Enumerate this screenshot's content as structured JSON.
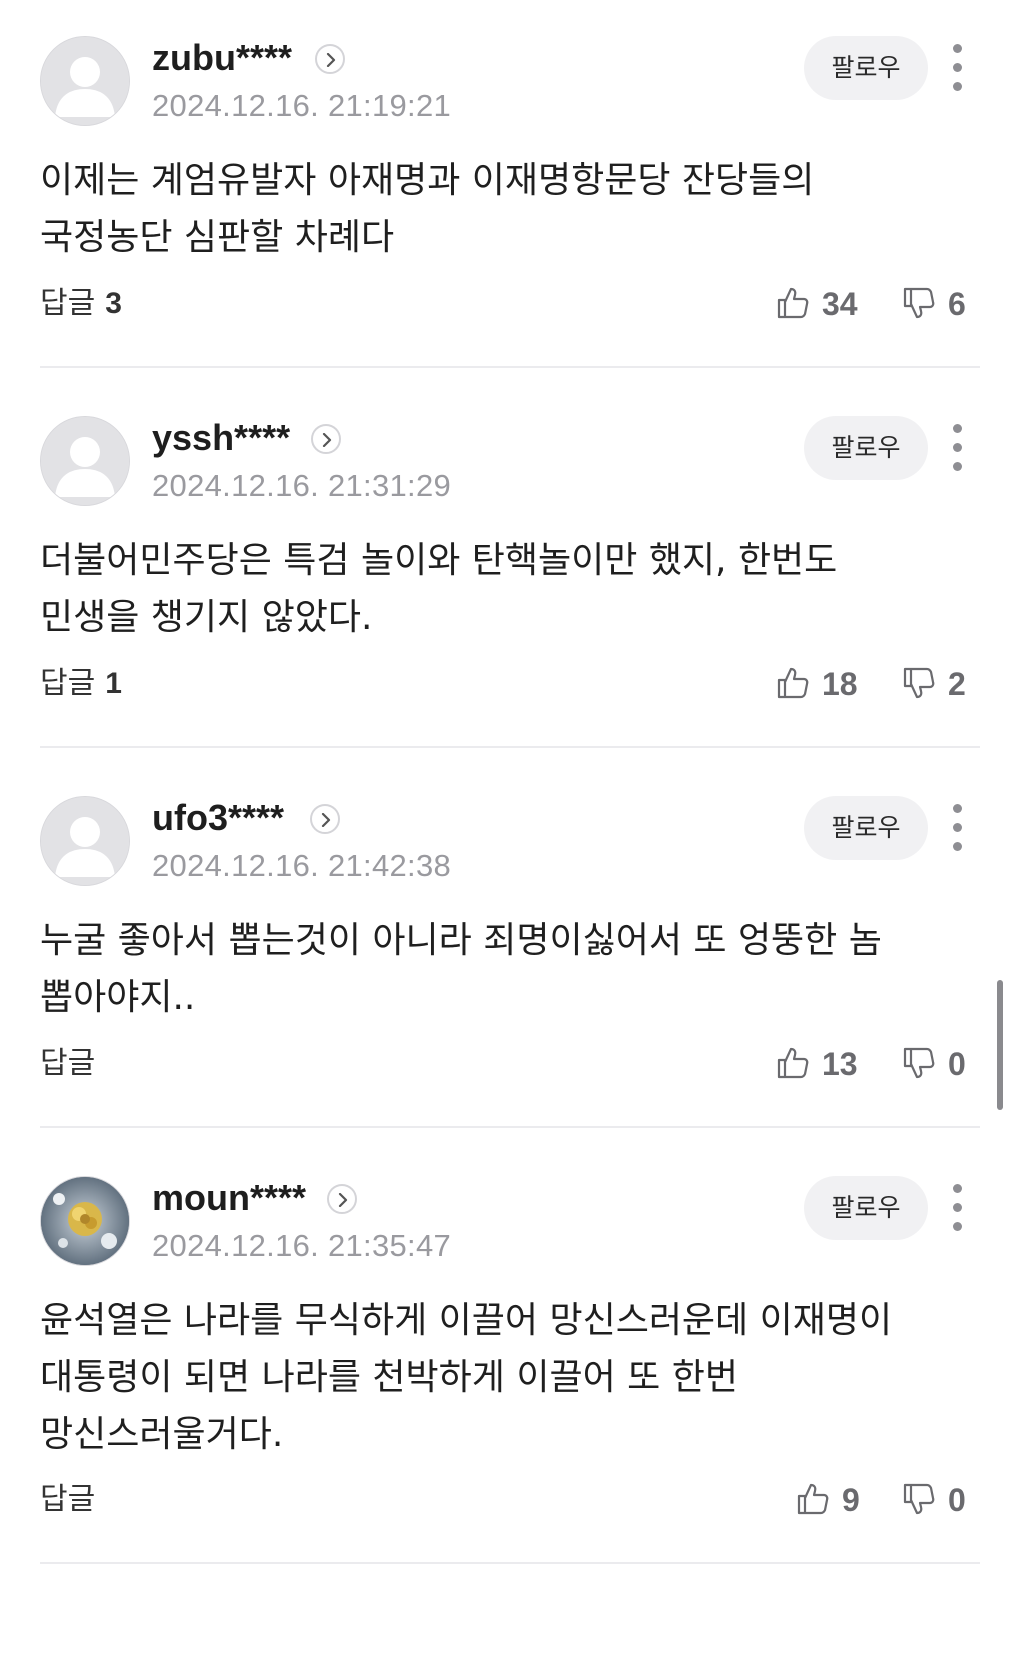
{
  "comments": [
    {
      "username": "zubu****",
      "timestamp": "2024.12.16. 21:19:21",
      "follow_label": "팔로우",
      "body": "이제는 계엄유발자 아재명과 이재명항문당 잔당들의 국정농단 심판할 차례다",
      "reply_label": "답글",
      "reply_count": "3",
      "likes": "34",
      "dislikes": "6",
      "avatar": "default-avatar-icon"
    },
    {
      "username": "yssh****",
      "timestamp": "2024.12.16. 21:31:29",
      "follow_label": "팔로우",
      "body": "더불어민주당은 특검 놀이와 탄핵놀이만 했지, 한번도 민생을 챙기지 않았다.",
      "reply_label": "답글",
      "reply_count": "1",
      "likes": "18",
      "dislikes": "2",
      "avatar": "default-avatar-icon"
    },
    {
      "username": "ufo3****",
      "timestamp": "2024.12.16. 21:42:38",
      "follow_label": "팔로우",
      "body": "누굴 좋아서 뽑는것이 아니라 죄명이싫어서 또 엉뚱한 놈 뽑아야지..",
      "reply_label": "답글",
      "reply_count": "",
      "likes": "13",
      "dislikes": "0",
      "avatar": "default-avatar-icon"
    },
    {
      "username": "moun****",
      "timestamp": "2024.12.16. 21:35:47",
      "follow_label": "팔로우",
      "body": "윤석열은 나라를 무식하게 이끌어 망신스러운데 이재명이 대통령이 되면 나라를 천박하게 이끌어 또 한번 망신스러울거다.",
      "reply_label": "답글",
      "reply_count": "",
      "likes": "9",
      "dislikes": "0",
      "avatar": "flower-photo-avatar"
    }
  ],
  "colors": {
    "follow_bg": "#f1f1f3",
    "timestamp": "#9a9a9f",
    "divider": "#ebebee",
    "vote_count": "#6a6a6e"
  },
  "icons": [
    "default-avatar-icon",
    "chevron-right-icon",
    "more-vertical-icon",
    "thumbs-up-icon",
    "thumbs-down-icon"
  ]
}
